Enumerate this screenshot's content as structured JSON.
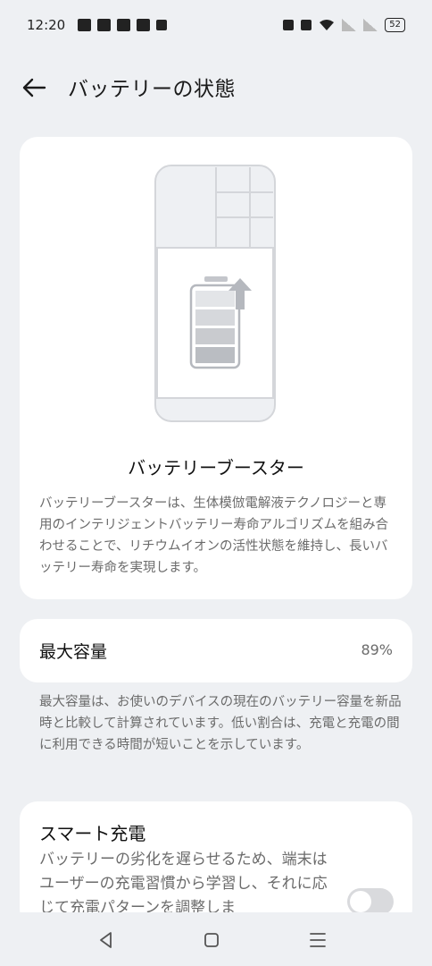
{
  "status_bar": {
    "time": "12:20",
    "battery": "52"
  },
  "header": {
    "title": "バッテリーの状態"
  },
  "booster": {
    "title": "バッテリーブースター",
    "description": "バッテリーブースターは、生体模倣電解液テクノロジーと専用のインテリジェントバッテリー寿命アルゴリズムを組み合わせることで、リチウムイオンの活性状態を維持し、長いバッテリー寿命を実現します。"
  },
  "capacity": {
    "label": "最大容量",
    "value": "89%",
    "description": "最大容量は、お使いのデバイスの現在のバッテリー容量を新品時と比較して計算されています。低い割合は、充電と充電の間に利用できる時間が短いことを示しています。"
  },
  "smart_charge": {
    "label": "スマート充電",
    "description": "バッテリーの劣化を遅らせるため、端末はユーザーの充電習慣から学習し、それに応じて充電パターンを調整しま",
    "enabled": false
  },
  "icons": {
    "back": "arrow-left-icon",
    "nav_back": "triangle-back-icon",
    "nav_home": "square-home-icon",
    "nav_recent": "menu-lines-icon"
  }
}
